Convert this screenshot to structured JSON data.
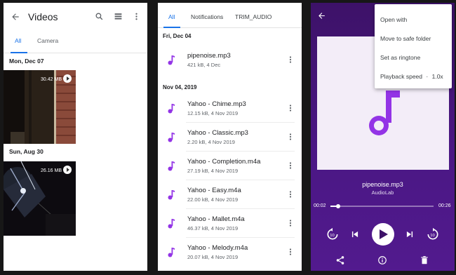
{
  "screen_videos": {
    "title": "Videos",
    "tabs": [
      {
        "label": "All",
        "active": true
      },
      {
        "label": "Camera",
        "active": false
      }
    ],
    "groups": [
      {
        "date": "Mon, Dec 07",
        "size": "30.42 MB"
      },
      {
        "date": "Sun, Aug 30",
        "size": "26.16 MB"
      }
    ]
  },
  "screen_audio": {
    "tabs": [
      {
        "label": "All",
        "active": true
      },
      {
        "label": "Notifications",
        "active": false
      },
      {
        "label": "TRIM_AUDIO",
        "active": false
      }
    ],
    "sections": [
      {
        "date": "Fri, Dec 04",
        "files": [
          {
            "name": "pipenoise.mp3",
            "meta": "421 kB, 4 Dec"
          }
        ]
      },
      {
        "date": "Nov 04, 2019",
        "files": [
          {
            "name": "Yahoo - Chime.mp3",
            "meta": "12.15 kB, 4 Nov 2019"
          },
          {
            "name": "Yahoo - Classic.mp3",
            "meta": "2.20 kB, 4 Nov 2019"
          },
          {
            "name": "Yahoo - Completion.m4a",
            "meta": "27.19 kB, 4 Nov 2019"
          },
          {
            "name": "Yahoo - Easy.m4a",
            "meta": "22.00 kB, 4 Nov 2019"
          },
          {
            "name": "Yahoo - Mallet.m4a",
            "meta": "46.37 kB, 4 Nov 2019"
          },
          {
            "name": "Yahoo - Melody.m4a",
            "meta": "20.07 kB, 4 Nov 2019"
          }
        ]
      }
    ]
  },
  "screen_player": {
    "menu": {
      "open_with": "Open with",
      "move_to_safe_folder": "Move to safe folder",
      "set_as_ringtone": "Set as ringtone",
      "playback_speed": "Playback speed",
      "playback_speed_value": "1.0x"
    },
    "track_title": "pipenoise.mp3",
    "track_artist": "AudioLab",
    "elapsed": "00:02",
    "duration": "00:26",
    "progress": 0.077
  },
  "colors": {
    "accent_blue": "#1a73e8",
    "note_purple": "#9334e6",
    "player_bg": "#4a1784"
  },
  "icons": [
    "back-arrow-icon",
    "search-icon",
    "list-view-icon",
    "more-vert-icon",
    "play-icon",
    "music-note-icon",
    "replay-10-icon",
    "skip-previous-icon",
    "play-button-icon",
    "skip-next-icon",
    "forward-10-icon",
    "share-icon",
    "info-icon",
    "delete-icon"
  ]
}
